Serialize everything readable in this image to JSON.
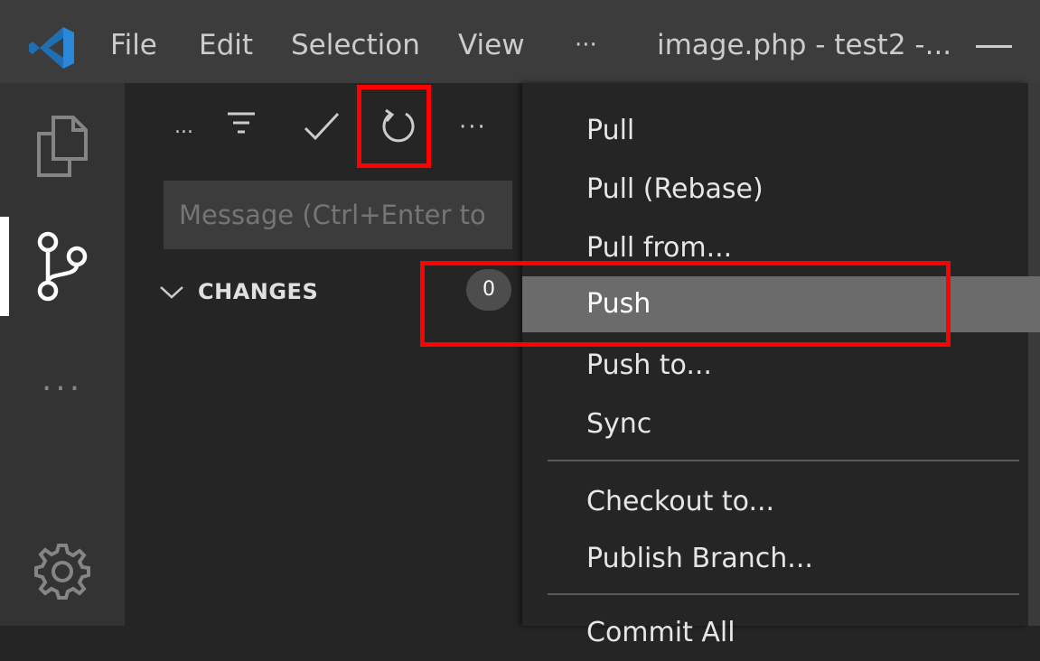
{
  "titlebar": {
    "menus": [
      "File",
      "Edit",
      "Selection",
      "View",
      "···"
    ],
    "window_title": "image.php - test2 -..."
  },
  "activity_bar": {
    "icons": [
      "explorer-icon",
      "source-control-icon",
      "more-icon",
      "settings-gear-icon"
    ],
    "more_glyph": "···"
  },
  "sidebar": {
    "toolbar": {
      "ellipsis_left": "...",
      "more": "···"
    },
    "message_placeholder": "Message (Ctrl+Enter to",
    "changes": {
      "label": "CHANGES",
      "count": "0"
    }
  },
  "context_menu": {
    "items": [
      {
        "label": "Pull"
      },
      {
        "label": "Pull (Rebase)"
      },
      {
        "label": "Pull from..."
      },
      {
        "label": "Push",
        "selected": true
      },
      {
        "label": "Push to..."
      },
      {
        "label": "Sync"
      },
      {
        "label": "Checkout to..."
      },
      {
        "label": "Publish Branch..."
      },
      {
        "label": "Commit All"
      }
    ]
  },
  "colors": {
    "titlebar": "#3c3c3c",
    "activitybar": "#333333",
    "sidebar": "#252526",
    "selected_item": "#6b6b6b",
    "highlight": "#ff0000",
    "vscode_blue": "#2b88d8"
  }
}
